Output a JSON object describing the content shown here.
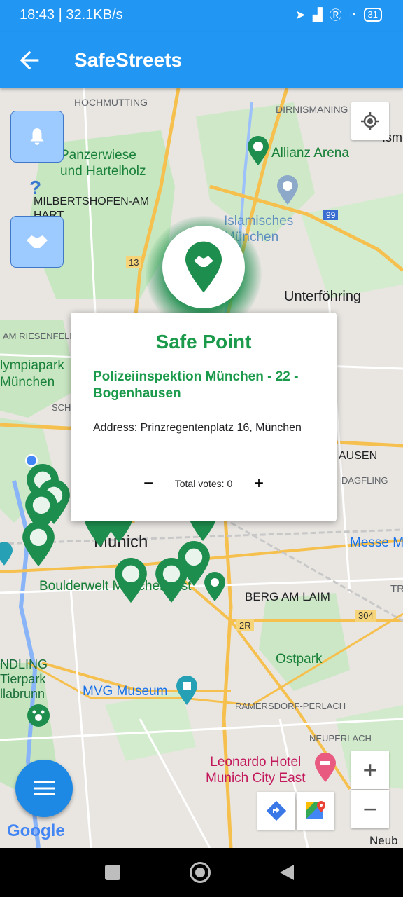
{
  "status_bar": {
    "time": "18:43 | 32.1KB/s",
    "battery": "31"
  },
  "app_bar": {
    "title": "SafeStreets"
  },
  "map": {
    "labels": {
      "hochmutting": "HOCHMUTTING",
      "dirnismaning": "DIRNISMANING",
      "panzerwiese": "Panzerwiese\nund Hartelholz",
      "allianz": "Allianz Arena",
      "ism": "Ism",
      "milbertshofen": "MILBERTSHOFEN-AM\nHART",
      "islamisches": "Islamisches\nMünchen",
      "road99": "99",
      "road13": "13",
      "unterfohring": "Unterföhring",
      "riesenfeld": "AM RIESENFELD",
      "olympiapark": "lympiapark\nMünchen",
      "schw": "SCHW",
      "hausen": "AUSEN",
      "dagfling": "DAGFLING",
      "munich": "Munich",
      "messe": "Messe M",
      "boulderwelt": "Boulderwelt München Ost",
      "tr": "TR",
      "bergamlaim": "BERG AM LAIM",
      "road304": "304",
      "road2r": "2R",
      "ostpark": "Ostpark",
      "ndling": "NDLING\nTierpark\nllabrunn",
      "mvg": "MVG Museum",
      "ramersdorf": "RAMERSDORF-PERLACH",
      "neuperlach": "NEUPERLACH",
      "leonardo": "Leonardo Hotel\nMunich City East",
      "neub": "Neub",
      "google": "Google"
    }
  },
  "popup": {
    "title": "Safe Point",
    "name": "Polizeiinspektion München - 22 - Bogenhausen",
    "address": "Address: Prinzregentenplatz 16, München",
    "votes_label": "Total votes: 0",
    "minus": "−",
    "plus": "+"
  },
  "controls": {
    "zoom_in": "+",
    "zoom_out": "−",
    "help": "?"
  },
  "colors": {
    "primary": "#2196f3",
    "safe_green": "#1a9a4a",
    "marker_green": "#1e8e4e"
  }
}
